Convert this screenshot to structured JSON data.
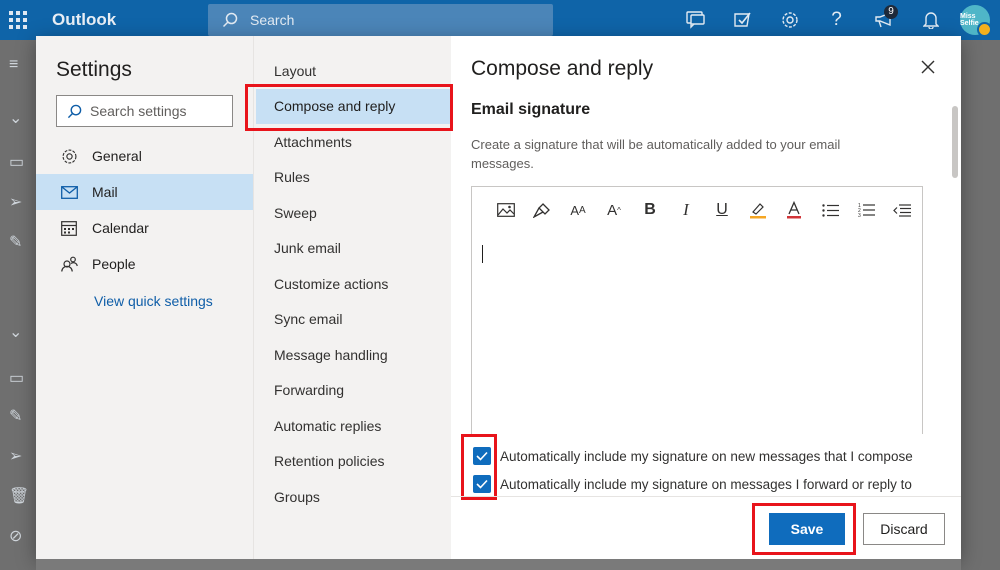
{
  "app": {
    "brand": "Outlook",
    "search_placeholder": "Search",
    "notification_count": "9",
    "avatar_text": "Miss Selfie"
  },
  "settings": {
    "title": "Settings",
    "search_placeholder": "Search settings",
    "nav": [
      {
        "label": "General",
        "icon": "gear-icon"
      },
      {
        "label": "Mail",
        "icon": "mail-icon",
        "active": true
      },
      {
        "label": "Calendar",
        "icon": "calendar-icon"
      },
      {
        "label": "People",
        "icon": "people-icon"
      }
    ],
    "quick_settings": "View quick settings"
  },
  "mail_nav": [
    "Layout",
    "Compose and reply",
    "Attachments",
    "Rules",
    "Sweep",
    "Junk email",
    "Customize actions",
    "Sync email",
    "Message handling",
    "Forwarding",
    "Automatic replies",
    "Retention policies",
    "Groups"
  ],
  "mail_nav_active": "Compose and reply",
  "panel": {
    "title": "Compose and reply",
    "section_title": "Email signature",
    "description": "Create a signature that will be automatically added to your email messages.",
    "toolbar": [
      "image-icon",
      "format-painter-icon",
      "font-size-icon",
      "grow-font-icon",
      "bold-icon",
      "italic-icon",
      "underline-icon",
      "highlight-icon",
      "font-color-icon",
      "bullets-icon",
      "numbering-icon",
      "decrease-indent-icon"
    ],
    "check_new": "Automatically include my signature on new messages that I compose",
    "check_forward": "Automatically include my signature on messages I forward or reply to",
    "check_new_checked": true,
    "check_forward_checked": true,
    "save_label": "Save",
    "discard_label": "Discard"
  },
  "colors": {
    "topbar": "#0f64a8",
    "accent": "#0f6cbd",
    "selected": "#c7e0f4",
    "highlight_box": "#e8141b"
  }
}
